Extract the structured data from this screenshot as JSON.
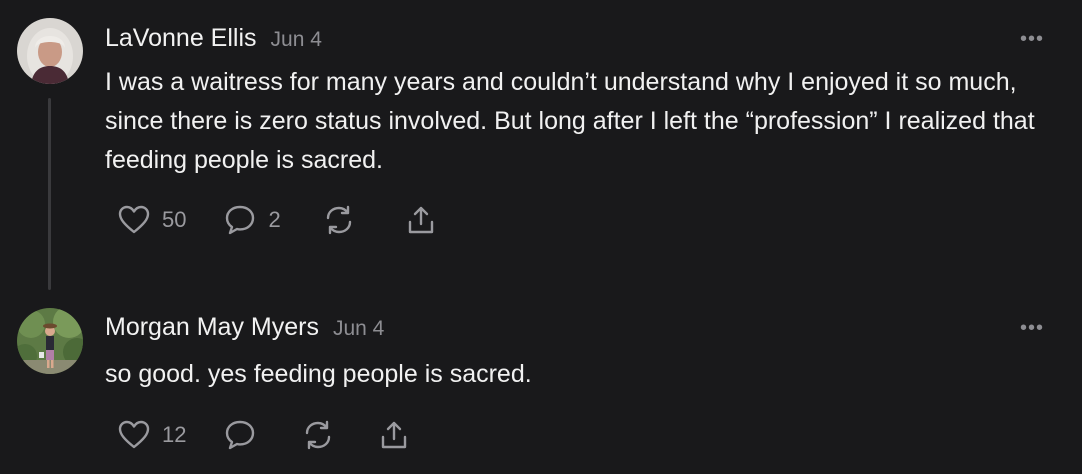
{
  "comments": [
    {
      "author": "LaVonne Ellis",
      "date": "Jun 4",
      "more": "•••",
      "text": "I was a waitress for many years and couldn’t understand why I enjoyed it so much, since there is zero status involved. But long after I left the “profession” I realized that feeding people is sacred.",
      "likes": "50",
      "replies": "2",
      "icons": [
        "heart-icon",
        "comment-icon",
        "restack-icon",
        "share-icon"
      ]
    },
    {
      "author": "Morgan May Myers",
      "date": "Jun 4",
      "more": "•••",
      "text": "so good. yes feeding people is sacred.",
      "likes": "12",
      "icons": [
        "heart-icon",
        "comment-icon",
        "restack-icon",
        "share-icon"
      ]
    }
  ],
  "colors": {
    "background": "#19191b",
    "text": "#f1f1f1",
    "muted": "#8d8d92",
    "thread_line": "#3a3a3d"
  }
}
